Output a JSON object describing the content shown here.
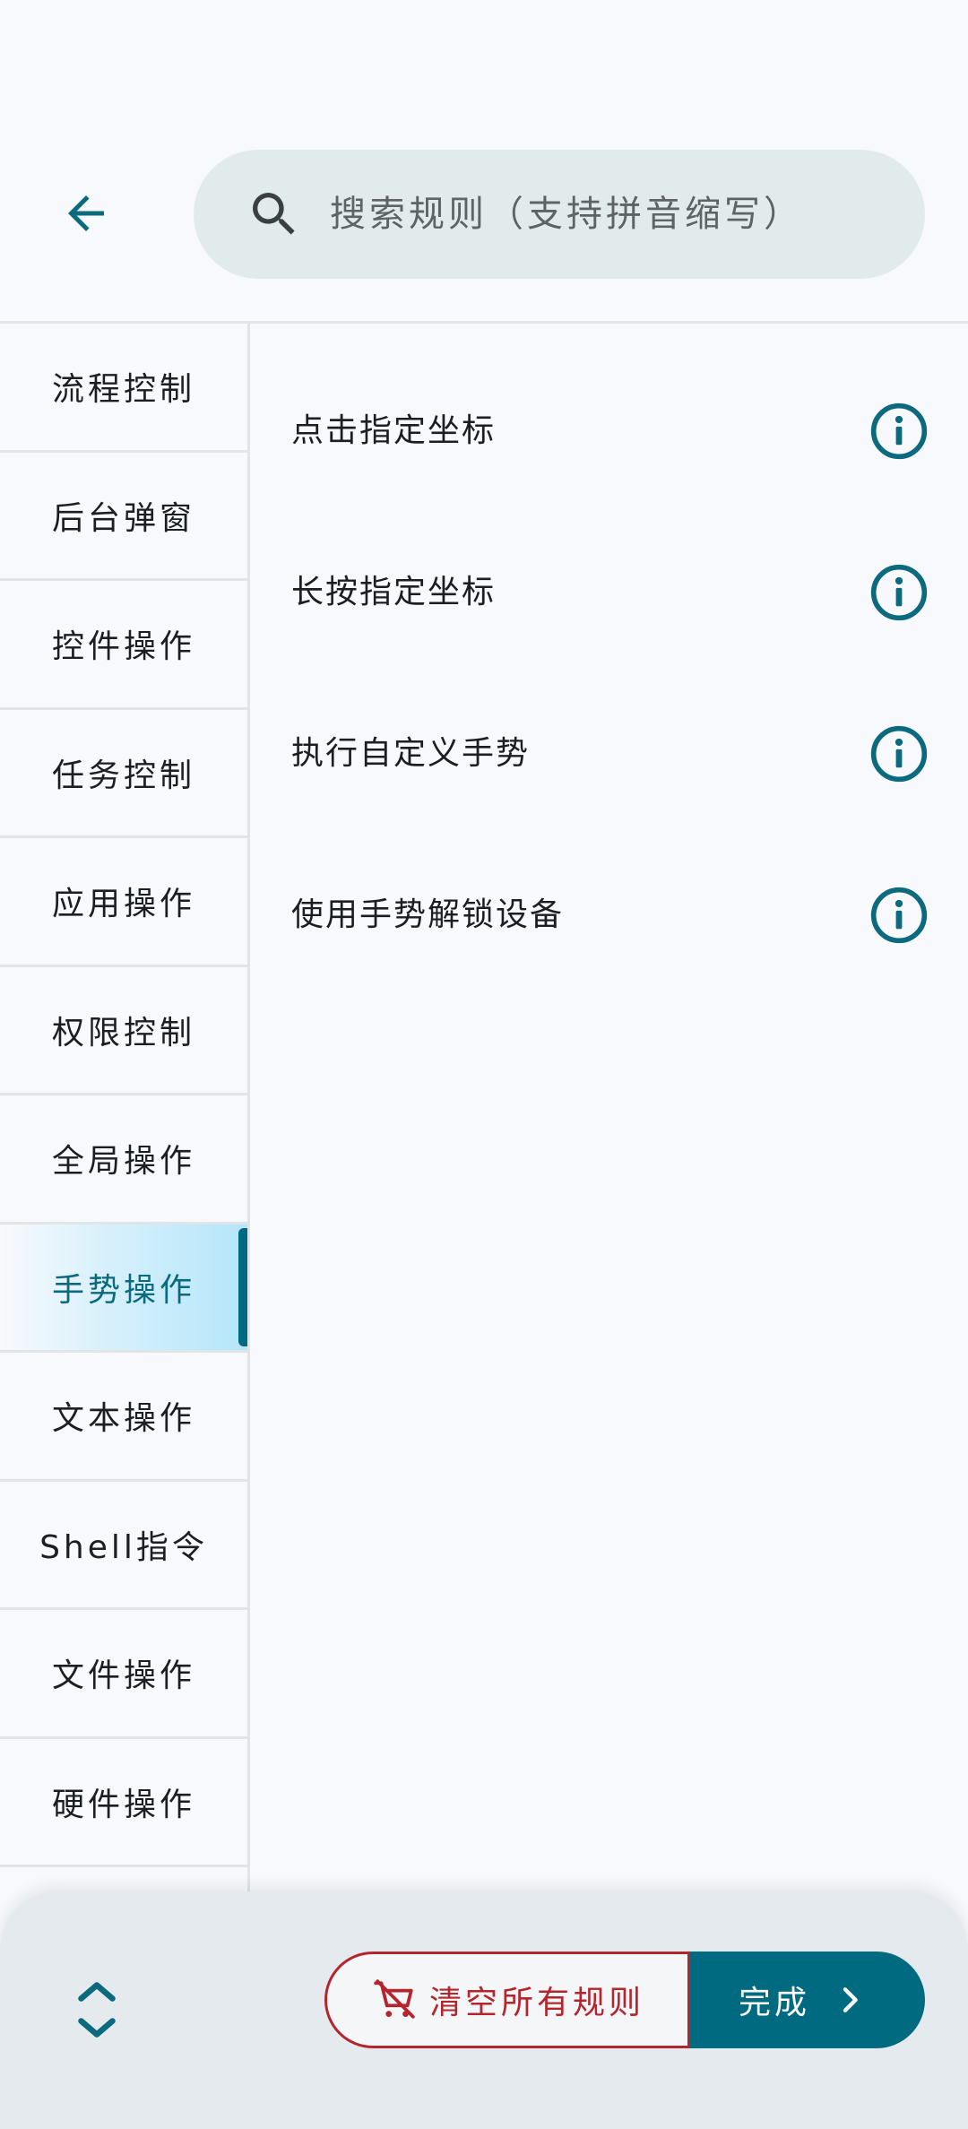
{
  "header": {
    "back_icon": "arrow-left-icon",
    "search": {
      "icon": "search-icon",
      "placeholder": "搜索规则（支持拼音缩写）",
      "value": ""
    }
  },
  "sidebar": {
    "items": [
      {
        "label": "流程控制",
        "selected": false
      },
      {
        "label": "后台弹窗",
        "selected": false
      },
      {
        "label": "控件操作",
        "selected": false
      },
      {
        "label": "任务控制",
        "selected": false
      },
      {
        "label": "应用操作",
        "selected": false
      },
      {
        "label": "权限控制",
        "selected": false
      },
      {
        "label": "全局操作",
        "selected": false
      },
      {
        "label": "手势操作",
        "selected": true
      },
      {
        "label": "文本操作",
        "selected": false
      },
      {
        "label": "Shell指令",
        "selected": false
      },
      {
        "label": "文件操作",
        "selected": false
      },
      {
        "label": "硬件操作",
        "selected": false
      }
    ]
  },
  "rules": {
    "items": [
      {
        "label": "点击指定坐标",
        "icon": "info-icon"
      },
      {
        "label": "长按指定坐标",
        "icon": "info-icon"
      },
      {
        "label": "执行自定义手势",
        "icon": "info-icon"
      },
      {
        "label": "使用手势解锁设备",
        "icon": "info-icon"
      }
    ]
  },
  "bottom_bar": {
    "collapse_icon": "unfold-icon",
    "clear_label": "清空所有规则",
    "clear_icon": "remove-cart-icon",
    "done_label": "完成",
    "done_icon": "chevron-right-icon"
  },
  "colors": {
    "accent": "#006a81",
    "danger": "#b3262d",
    "selected_bg": "#b4e6fb",
    "search_bg": "#e1ebeb"
  }
}
